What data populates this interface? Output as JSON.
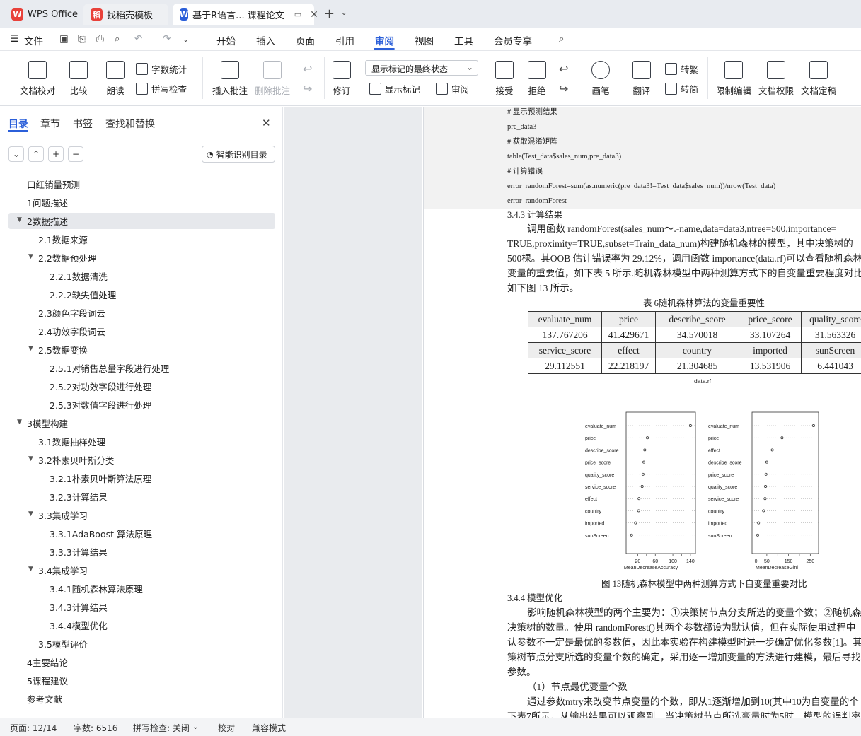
{
  "tabs": [
    {
      "label": "WPS Office",
      "icon": "wps-logo-icon"
    },
    {
      "label": "找稻壳模板",
      "icon": "docer-icon"
    },
    {
      "label": "基于R语言... 课程论文",
      "icon": "word-doc-icon"
    }
  ],
  "menu": {
    "file": "文件",
    "items": [
      "开始",
      "插入",
      "页面",
      "引用",
      "审阅",
      "视图",
      "工具",
      "会员专享"
    ],
    "active": "审阅"
  },
  "ribbon": {
    "doc_proofread": "文档校对",
    "compare": "比较",
    "read_aloud": "朗读",
    "word_count": "字数统计",
    "spell_check": "拼写检查",
    "insert_comment": "插入批注",
    "delete_comment": "删除批注",
    "revise": "修订",
    "markup_select": "显示标记的最终状态",
    "show_markup": "显示标记",
    "review": "审阅",
    "accept": "接受",
    "reject": "拒绝",
    "pen": "画笔",
    "translate": "翻译",
    "to_traditional": "转繁",
    "to_simplified": "转简",
    "restrict_edit": "限制编辑",
    "doc_permission": "文档权限",
    "doc_finalize": "文档定稿"
  },
  "sidebar": {
    "tabs": [
      "目录",
      "章节",
      "书签",
      "查找和替换"
    ],
    "smart_button": "智能识别目录",
    "toc": [
      {
        "label": "口红销量预测",
        "level": 0,
        "caret": ""
      },
      {
        "label": "1问题描述",
        "level": 0,
        "caret": ""
      },
      {
        "label": "2数据描述",
        "level": 0,
        "caret": "▼",
        "selected": true
      },
      {
        "label": "2.1数据来源",
        "level": 1,
        "caret": ""
      },
      {
        "label": "2.2数据预处理",
        "level": 1,
        "caret": "▼"
      },
      {
        "label": "2.2.1数据清洗",
        "level": 2,
        "caret": ""
      },
      {
        "label": "2.2.2缺失值处理",
        "level": 2,
        "caret": ""
      },
      {
        "label": "2.3颜色字段词云",
        "level": 1,
        "caret": ""
      },
      {
        "label": "2.4功效字段词云",
        "level": 1,
        "caret": ""
      },
      {
        "label": "2.5数据变换",
        "level": 1,
        "caret": "▼"
      },
      {
        "label": "2.5.1对销售总量字段进行处理",
        "level": 2,
        "caret": ""
      },
      {
        "label": "2.5.2对功效字段进行处理",
        "level": 2,
        "caret": ""
      },
      {
        "label": "2.5.3对数值字段进行处理",
        "level": 2,
        "caret": ""
      },
      {
        "label": "3模型构建",
        "level": 0,
        "caret": "▼"
      },
      {
        "label": "3.1数据抽样处理",
        "level": 1,
        "caret": ""
      },
      {
        "label": "3.2朴素贝叶斯分类",
        "level": 1,
        "caret": "▼"
      },
      {
        "label": "3.2.1朴素贝叶斯算法原理",
        "level": 2,
        "caret": ""
      },
      {
        "label": "3.2.3计算结果",
        "level": 2,
        "caret": ""
      },
      {
        "label": "3.3集成学习",
        "level": 1,
        "caret": "▼"
      },
      {
        "label": "3.3.1AdaBoost 算法原理",
        "level": 2,
        "caret": ""
      },
      {
        "label": "3.3.3计算结果",
        "level": 2,
        "caret": ""
      },
      {
        "label": "3.4集成学习",
        "level": 1,
        "caret": "▼"
      },
      {
        "label": "3.4.1随机森林算法原理",
        "level": 2,
        "caret": ""
      },
      {
        "label": "3.4.3计算结果",
        "level": 2,
        "caret": ""
      },
      {
        "label": "3.4.4模型优化",
        "level": 2,
        "caret": ""
      },
      {
        "label": "3.5模型评价",
        "level": 1,
        "caret": ""
      },
      {
        "label": "4主要结论",
        "level": 0,
        "caret": ""
      },
      {
        "label": "5课程建议",
        "level": 0,
        "caret": ""
      },
      {
        "label": "参考文献",
        "level": 0,
        "caret": ""
      }
    ]
  },
  "document": {
    "code_lines": [
      "# 显示预测结果",
      "pre_data3",
      "# 获取混淆矩阵",
      "table(Test_data$sales_num,pre_data3)",
      "# 计算错误",
      "error_randomForest=sum(as.numeric(pre_data3!=Test_data$sales_num))/nrow(Test_data)",
      "error_randomForest"
    ],
    "heading_343": "3.4.3 计算结果",
    "para1": [
      "调用函数 randomForest(sales_num～.-name,data=data3,ntree=500,importance=",
      "TRUE,proximity=TRUE,subset=Train_data_num)构建随机森林的模型，其中决策树的",
      "500棵。其OOB 估计错误率为 29.12%，调用函数 importance(data.rf)可以查看随机森林",
      "变量的重要值，如下表 5 所示.随机森林模型中两种测算方式下的自变量重要程度对比",
      "如下图 13 所示。"
    ],
    "table_caption": "表 6随机森林算法的变量重要性",
    "table_rows": [
      [
        "evaluate_num",
        "price",
        "describe_score",
        "price_score",
        "quality_score"
      ],
      [
        "137.767206",
        "41.429671",
        "34.570018",
        "33.107264",
        "31.563326"
      ],
      [
        "service_score",
        "effect",
        "country",
        "imported",
        "sunScreen"
      ],
      [
        "29.112551",
        "22.218197",
        "21.304685",
        "13.531906",
        "6.441043"
      ]
    ],
    "figure_caption": "图 13随机森林模型中两种测算方式下自变量重要对比",
    "heading_344": "3.4.4 模型优化",
    "para2": [
      "影响随机森林模型的两个主要为：①决策树节点分支所选的变量个数；②随机森",
      "决策树的数量。使用 randomForest()其两个参数都设为默认值，但在实际使用过程中",
      "认参数不一定是最优的参数值，因此本实验在构建模型时进一步确定优化参数[1]。其",
      "策树节点分支所选的变量个数的确定，采用逐一增加变量的方法进行建模，最后寻找",
      "参数。"
    ],
    "sub_heading": "（1）节点最优变量个数",
    "para3": [
      "通过参数mtry来改变节点变量的个数，即从1逐渐增加到10(其中10为自变量的个",
      "下表7所示。从输出结果可以观察到，当决策树节点所选变量时为5时，模型的误判率"
    ]
  },
  "chart_data": {
    "type": "scatter",
    "title": "data.rf",
    "panels": [
      {
        "xlabel": "MeanDecreaseAccuracy",
        "ticks": [
          20,
          60,
          100,
          140
        ],
        "minor_ticks": [
          40,
          80,
          120
        ],
        "xlim": [
          0,
          145
        ],
        "categories": [
          "evaluate_num",
          "price",
          "describe_score",
          "price_score",
          "quality_score",
          "service_score",
          "effect",
          "country",
          "imported",
          "sunScreen"
        ],
        "values": [
          140,
          42,
          36,
          34,
          32,
          30,
          23,
          22,
          15,
          6
        ]
      },
      {
        "xlabel": "MeanDecreaseGini",
        "ticks": [
          0,
          50,
          150,
          250
        ],
        "minor_ticks": [
          100,
          200
        ],
        "xlim": [
          -5,
          275
        ],
        "categories": [
          "evaluate_num",
          "price",
          "effect",
          "describe_score",
          "price_score",
          "quality_score",
          "service_score",
          "country",
          "imported",
          "sunScreen"
        ],
        "values": [
          265,
          120,
          75,
          50,
          46,
          44,
          42,
          35,
          12,
          8
        ]
      }
    ]
  },
  "status": {
    "page": "页面: 12/14",
    "words": "字数: 6516",
    "spell": "拼写检查: 关闭",
    "proof": "校对",
    "compat": "兼容模式"
  },
  "colors": {
    "accent": "#2b5fd9",
    "wps_red": "#e8413a"
  }
}
